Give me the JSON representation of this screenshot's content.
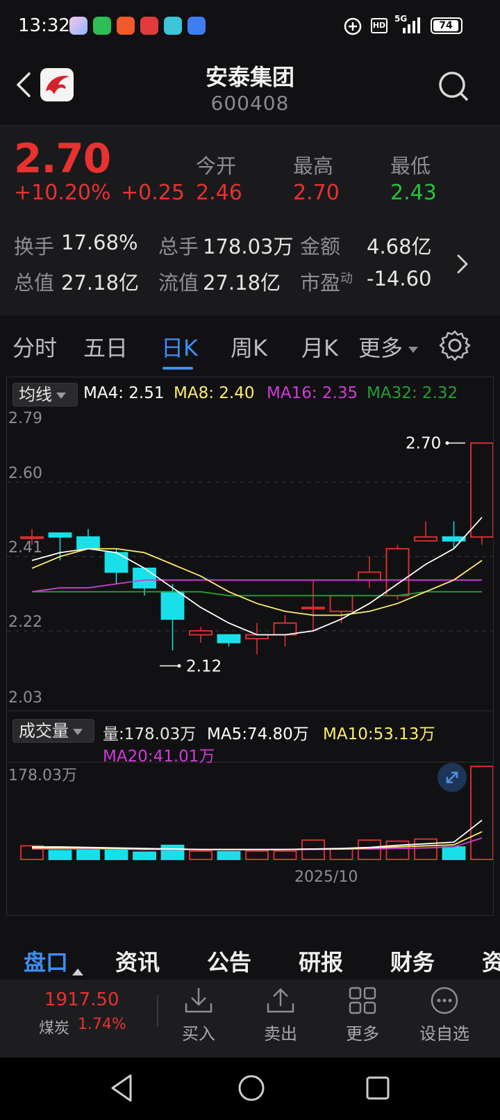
{
  "status_bar": {
    "time": "13:32",
    "network": "5G",
    "battery": "74",
    "hd": "HD"
  },
  "header": {
    "title": "安泰集团",
    "code": "600408"
  },
  "quote": {
    "price": "2.70",
    "change_pct": "+10.20%",
    "change": "+0.25",
    "open_label": "今开",
    "open": "2.46",
    "high_label": "最高",
    "high": "2.70",
    "low_label": "最低",
    "low": "2.43",
    "turnover_label": "换手",
    "turnover": "17.68%",
    "volume_label": "总手",
    "volume": "178.03万",
    "amount_label": "金额",
    "amount": "4.68亿",
    "total_cap_label": "总值",
    "total_cap": "27.18亿",
    "float_cap_label": "流值",
    "float_cap": "27.18亿",
    "pe_label": "市盈",
    "pe_sup": "动",
    "pe": "-14.60"
  },
  "period_tabs": [
    "分时",
    "五日",
    "日K",
    "周K",
    "月K",
    "更多"
  ],
  "period_active": "日K",
  "ma_bar": {
    "selector": "均线",
    "ma4": "MA4: 2.51",
    "ma8": "MA8: 2.40",
    "ma16": "MA16: 2.35",
    "ma32": "MA32: 2.32"
  },
  "price_axis": [
    "2.79",
    "2.60",
    "2.41",
    "2.22",
    "2.03"
  ],
  "annotations": {
    "high": "2.70",
    "low": "2.12"
  },
  "volume_bar": {
    "selector": "成交量",
    "vol": "量:178.03万",
    "ma5": "MA5:74.80万",
    "ma10": "MA10:53.13万",
    "ma20": "MA20:41.01万",
    "axis_max": "178.03万",
    "date_label": "2025/10"
  },
  "info_tabs": [
    "盘口",
    "资讯",
    "公告",
    "研报",
    "财务",
    "资"
  ],
  "info_active": "盘口",
  "index_ticker": {
    "value": "1917.50",
    "name": "煤炭",
    "change": "1.74%"
  },
  "actions": [
    "买入",
    "卖出",
    "更多",
    "设自选"
  ],
  "colors": {
    "up": "#e8322f",
    "down": "#19e0e8",
    "ma4": "#ffffff",
    "ma8": "#ffec6e",
    "ma16": "#d23ad9",
    "ma32": "#23a036",
    "accent": "#3e8ef0"
  },
  "chart_data": {
    "type": "candlestick",
    "candles": [
      {
        "o": 2.46,
        "c": 2.46,
        "h": 2.48,
        "l": 2.44,
        "dir": "up"
      },
      {
        "o": 2.47,
        "c": 2.46,
        "h": 2.47,
        "l": 2.4,
        "dir": "down"
      },
      {
        "o": 2.46,
        "c": 2.43,
        "h": 2.48,
        "l": 2.43,
        "dir": "down"
      },
      {
        "o": 2.42,
        "c": 2.37,
        "h": 2.43,
        "l": 2.34,
        "dir": "down"
      },
      {
        "o": 2.38,
        "c": 2.33,
        "h": 2.38,
        "l": 2.31,
        "dir": "down"
      },
      {
        "o": 2.32,
        "c": 2.25,
        "h": 2.34,
        "l": 2.17,
        "dir": "down"
      },
      {
        "o": 2.21,
        "c": 2.22,
        "h": 2.23,
        "l": 2.19,
        "dir": "up"
      },
      {
        "o": 2.21,
        "c": 2.19,
        "h": 2.21,
        "l": 2.18,
        "dir": "down"
      },
      {
        "o": 2.21,
        "c": 2.2,
        "h": 2.24,
        "l": 2.16,
        "dir": "up"
      },
      {
        "o": 2.21,
        "c": 2.24,
        "h": 2.26,
        "l": 2.18,
        "dir": "up"
      },
      {
        "o": 2.28,
        "c": 2.28,
        "h": 2.35,
        "l": 2.22,
        "dir": "up"
      },
      {
        "o": 2.27,
        "c": 2.31,
        "h": 2.31,
        "l": 2.24,
        "dir": "up"
      },
      {
        "o": 2.35,
        "c": 2.37,
        "h": 2.41,
        "l": 2.33,
        "dir": "up"
      },
      {
        "o": 2.31,
        "c": 2.43,
        "h": 2.44,
        "l": 2.3,
        "dir": "up"
      },
      {
        "o": 2.45,
        "c": 2.46,
        "h": 2.5,
        "l": 2.45,
        "dir": "up"
      },
      {
        "o": 2.45,
        "c": 2.46,
        "h": 2.5,
        "l": 2.43,
        "dir": "down"
      },
      {
        "o": 2.46,
        "c": 2.7,
        "h": 2.7,
        "l": 2.44,
        "dir": "up"
      }
    ],
    "ma4": [
      2.4,
      2.42,
      2.43,
      2.42,
      2.38,
      2.33,
      2.28,
      2.24,
      2.21,
      2.21,
      2.22,
      2.25,
      2.29,
      2.34,
      2.39,
      2.43,
      2.51
    ],
    "ma8": [
      2.38,
      2.41,
      2.43,
      2.43,
      2.42,
      2.39,
      2.36,
      2.32,
      2.29,
      2.27,
      2.26,
      2.26,
      2.27,
      2.29,
      2.32,
      2.35,
      2.4
    ],
    "ma16": [
      2.32,
      2.33,
      2.33,
      2.34,
      2.35,
      2.35,
      2.35,
      2.35,
      2.35,
      2.35,
      2.35,
      2.35,
      2.35,
      2.35,
      2.35,
      2.35,
      2.35
    ],
    "ma32": [
      2.32,
      2.32,
      2.32,
      2.32,
      2.32,
      2.32,
      2.32,
      2.31,
      2.31,
      2.31,
      2.31,
      2.31,
      2.31,
      2.31,
      2.32,
      2.32,
      2.32
    ],
    "ylim": [
      2.03,
      2.79
    ],
    "volume": [
      26,
      17,
      21,
      19,
      14,
      27,
      16,
      15,
      16,
      16,
      37,
      20,
      37,
      35,
      39,
      24,
      178
    ],
    "volume_ma5": [
      24,
      24,
      23,
      22,
      21,
      20,
      19,
      19,
      19,
      19,
      20,
      21,
      23,
      27,
      30,
      33,
      75
    ],
    "volume_ma10": [
      22,
      22,
      22,
      21,
      20,
      20,
      19,
      19,
      19,
      19,
      20,
      20,
      22,
      24,
      26,
      28,
      53
    ],
    "volume_ma20": [
      20,
      20,
      20,
      20,
      19,
      19,
      19,
      19,
      19,
      19,
      19,
      20,
      20,
      21,
      22,
      24,
      41
    ],
    "volume_ylim": [
      0,
      178.03
    ]
  }
}
